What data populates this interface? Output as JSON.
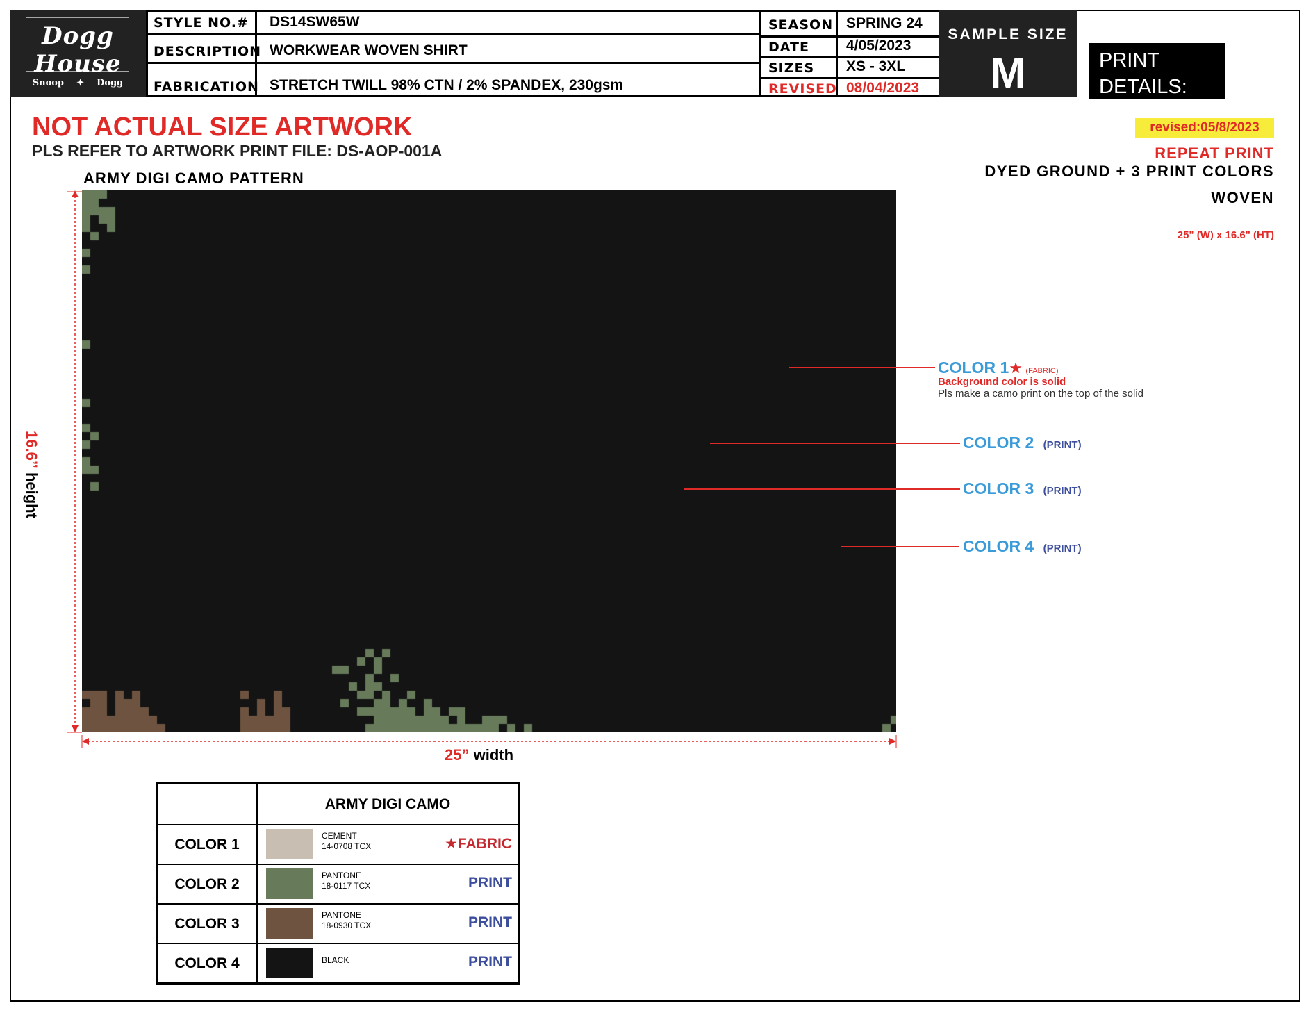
{
  "logo": {
    "brand": "Dogg House",
    "sub_left": "Snoop",
    "sub_right": "Dogg"
  },
  "header": {
    "style_label": "STYLE NO.#",
    "style_value": "DS14SW65W",
    "description_label": "DESCRIPTION",
    "description_value": "WORKWEAR WOVEN SHIRT",
    "fabrication_label": "FABRICATION",
    "fabrication_value": "STRETCH TWILL 98% CTN / 2% SPANDEX, 230gsm",
    "season_label": "SEASON",
    "season_value": "SPRING 24",
    "date_label": "DATE",
    "date_value": "4/05/2023",
    "sizes_label": "SIZES",
    "sizes_value": "XS - 3XL",
    "revised_label": "REVISED",
    "revised_value": "08/04/2023"
  },
  "sample": {
    "title": "SAMPLE SIZE",
    "size": "M"
  },
  "print_details": {
    "line1": "PRINT",
    "line2": "DETAILS:"
  },
  "notes": {
    "not_actual": "NOT ACTUAL SIZE ARTWORK",
    "refer": "PLS REFER TO ARTWORK PRINT FILE: DS-AOP-001A",
    "pattern_title": "ARMY DIGI CAMO PATTERN",
    "revised_badge": "revised:05/8/2023",
    "repeat": "REPEAT PRINT",
    "dyed": "DYED GROUND + 3 PRINT COLORS",
    "woven": "WOVEN",
    "dimensions": "25\" (W) x 16.6\" (HT)"
  },
  "measure": {
    "width_num": "25”",
    "width_word": " width",
    "height_num": "16.6”",
    "height_word": " height"
  },
  "callouts": {
    "c1_label": "COLOR 1",
    "c1_star": "★",
    "c1_tag": "(FABRIC)",
    "c1_note_red": "Background color is solid",
    "c1_note": "Pls make a camo print on the top of the solid",
    "c2_label": "COLOR 2",
    "c2_tag": "(PRINT)",
    "c3_label": "COLOR 3",
    "c3_tag": "(PRINT)",
    "c4_label": "COLOR 4",
    "c4_tag": "(PRINT)"
  },
  "legend": {
    "title": "ARMY DIGI CAMO",
    "rows": [
      {
        "name": "COLOR 1",
        "line1": "CEMENT",
        "line2": "14-0708 TCX",
        "type": "★FABRIC",
        "hex": "#c8bfb2"
      },
      {
        "name": "COLOR 2",
        "line1": "PANTONE",
        "line2": "18-0117 TCX",
        "type": "PRINT",
        "hex": "#677b5b"
      },
      {
        "name": "COLOR 3",
        "line1": "PANTONE",
        "line2": "18-0930 TCX",
        "type": "PRINT",
        "hex": "#6e5440"
      },
      {
        "name": "COLOR 4",
        "line1": "BLACK",
        "line2": "",
        "type": "PRINT",
        "hex": "#141414"
      }
    ]
  }
}
